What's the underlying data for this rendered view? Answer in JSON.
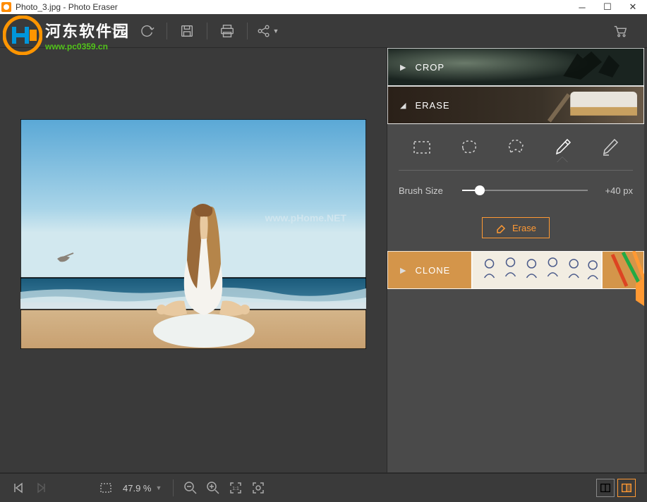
{
  "titlebar": {
    "title": "Photo_3.jpg - Photo Eraser"
  },
  "watermark": {
    "text_cn": "河东软件园",
    "url": "www.pc0359.cn",
    "photo_overlay": "www.pHome.NET"
  },
  "toolbar": {
    "icons": {
      "undo": "undo-icon",
      "redo": "redo-icon",
      "save": "save-icon",
      "print": "print-icon",
      "share": "share-icon",
      "cart": "cart-icon"
    }
  },
  "accordion": {
    "crop": {
      "label": "CROP"
    },
    "erase": {
      "label": "ERASE",
      "tools": [
        "rect-select",
        "lasso",
        "poly-lasso",
        "brush",
        "eraser-brush"
      ],
      "active_tool": "brush",
      "brush_label": "Brush Size",
      "brush_value": "+40 px",
      "erase_button": "Erase"
    },
    "clone": {
      "label": "CLONE"
    }
  },
  "bottombar": {
    "zoom_label": "47.9 %",
    "icons": {
      "first": "first-icon",
      "next": "next-icon",
      "grid": "grid-icon",
      "zoom_out": "zoom-out-icon",
      "zoom_in": "zoom-in-icon",
      "fit": "fit-icon",
      "actual": "actual-icon",
      "before_after_h": "compare-h-icon",
      "before_after_v": "compare-v-icon"
    }
  },
  "colors": {
    "accent": "#ff9933",
    "panel": "#4a4a4a",
    "bg": "#3a3a3a"
  }
}
